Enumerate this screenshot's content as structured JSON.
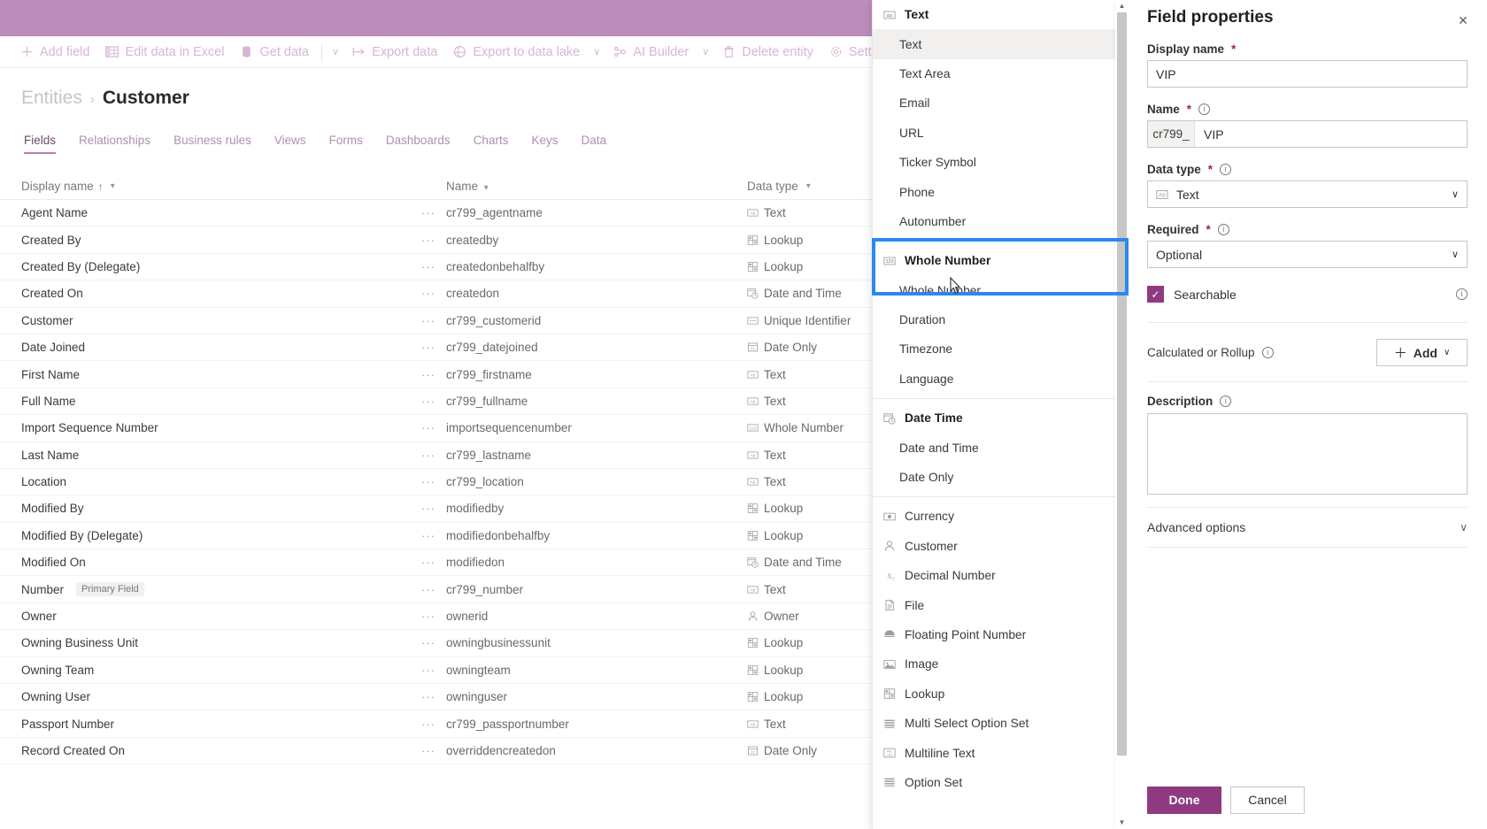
{
  "app": {
    "header_color": "#bb8dba",
    "accent_color": "#8f3a80",
    "focus_ring_color": "#2b88f0"
  },
  "command_bar": {
    "items": [
      {
        "label": "Add field",
        "icon": "plus-icon"
      },
      {
        "label": "Edit data in Excel",
        "icon": "excel-icon"
      },
      {
        "label": "Get data",
        "icon": "database-icon",
        "has_chevron": true
      },
      {
        "label": "Export data",
        "icon": "export-icon"
      },
      {
        "label": "Export to data lake",
        "icon": "datalake-icon",
        "has_chevron": true
      },
      {
        "label": "AI Builder",
        "icon": "ai-builder-icon",
        "has_chevron": true
      },
      {
        "label": "Delete entity",
        "icon": "trash-icon"
      },
      {
        "label": "Settings",
        "icon": "gear-icon"
      }
    ]
  },
  "breadcrumb": {
    "root": "Entities",
    "separator": "›",
    "current": "Customer"
  },
  "tabs": [
    {
      "label": "Fields",
      "active": true
    },
    {
      "label": "Relationships",
      "active": false
    },
    {
      "label": "Business rules",
      "active": false
    },
    {
      "label": "Views",
      "active": false
    },
    {
      "label": "Forms",
      "active": false
    },
    {
      "label": "Dashboards",
      "active": false
    },
    {
      "label": "Charts",
      "active": false
    },
    {
      "label": "Keys",
      "active": false
    },
    {
      "label": "Data",
      "active": false
    }
  ],
  "grid": {
    "columns": [
      {
        "label": "Display name",
        "sorted": "asc",
        "sort_glyph": "↑"
      },
      {
        "label": "Name"
      },
      {
        "label": "Data type"
      }
    ],
    "rows": [
      {
        "display_name": "Agent Name",
        "badge": "",
        "name": "cr799_agentname",
        "data_type": "Text",
        "type_icon": "text-icon"
      },
      {
        "display_name": "Created By",
        "badge": "",
        "name": "createdby",
        "data_type": "Lookup",
        "type_icon": "lookup-icon"
      },
      {
        "display_name": "Created By (Delegate)",
        "badge": "",
        "name": "createdonbehalfby",
        "data_type": "Lookup",
        "type_icon": "lookup-icon"
      },
      {
        "display_name": "Created On",
        "badge": "",
        "name": "createdon",
        "data_type": "Date and Time",
        "type_icon": "datetime-icon"
      },
      {
        "display_name": "Customer",
        "badge": "",
        "name": "cr799_customerid",
        "data_type": "Unique Identifier",
        "type_icon": "guid-icon"
      },
      {
        "display_name": "Date Joined",
        "badge": "",
        "name": "cr799_datejoined",
        "data_type": "Date Only",
        "type_icon": "dateonly-icon"
      },
      {
        "display_name": "First Name",
        "badge": "",
        "name": "cr799_firstname",
        "data_type": "Text",
        "type_icon": "text-icon"
      },
      {
        "display_name": "Full Name",
        "badge": "",
        "name": "cr799_fullname",
        "data_type": "Text",
        "type_icon": "text-icon"
      },
      {
        "display_name": "Import Sequence Number",
        "badge": "",
        "name": "importsequencenumber",
        "data_type": "Whole Number",
        "type_icon": "wholenumber-icon"
      },
      {
        "display_name": "Last Name",
        "badge": "",
        "name": "cr799_lastname",
        "data_type": "Text",
        "type_icon": "text-icon"
      },
      {
        "display_name": "Location",
        "badge": "",
        "name": "cr799_location",
        "data_type": "Text",
        "type_icon": "text-icon"
      },
      {
        "display_name": "Modified By",
        "badge": "",
        "name": "modifiedby",
        "data_type": "Lookup",
        "type_icon": "lookup-icon"
      },
      {
        "display_name": "Modified By (Delegate)",
        "badge": "",
        "name": "modifiedonbehalfby",
        "data_type": "Lookup",
        "type_icon": "lookup-icon"
      },
      {
        "display_name": "Modified On",
        "badge": "",
        "name": "modifiedon",
        "data_type": "Date and Time",
        "type_icon": "datetime-icon"
      },
      {
        "display_name": "Number",
        "badge": "Primary Field",
        "name": "cr799_number",
        "data_type": "Text",
        "type_icon": "text-icon"
      },
      {
        "display_name": "Owner",
        "badge": "",
        "name": "ownerid",
        "data_type": "Owner",
        "type_icon": "owner-icon"
      },
      {
        "display_name": "Owning Business Unit",
        "badge": "",
        "name": "owningbusinessunit",
        "data_type": "Lookup",
        "type_icon": "lookup-icon"
      },
      {
        "display_name": "Owning Team",
        "badge": "",
        "name": "owningteam",
        "data_type": "Lookup",
        "type_icon": "lookup-icon"
      },
      {
        "display_name": "Owning User",
        "badge": "",
        "name": "owninguser",
        "data_type": "Lookup",
        "type_icon": "lookup-icon"
      },
      {
        "display_name": "Passport Number",
        "badge": "",
        "name": "cr799_passportnumber",
        "data_type": "Text",
        "type_icon": "text-icon"
      },
      {
        "display_name": "Record Created On",
        "badge": "",
        "name": "overriddencreatedon",
        "data_type": "Date Only",
        "type_icon": "dateonly-icon"
      }
    ],
    "row_ellipsis": "···"
  },
  "type_menu": {
    "entries": [
      {
        "kind": "group",
        "label": "Text",
        "icon": "text-icon"
      },
      {
        "kind": "item",
        "label": "Text",
        "selected": true
      },
      {
        "kind": "item",
        "label": "Text Area",
        "selected": false
      },
      {
        "kind": "item",
        "label": "Email",
        "selected": false
      },
      {
        "kind": "item",
        "label": "URL",
        "selected": false
      },
      {
        "kind": "item",
        "label": "Ticker Symbol",
        "selected": false
      },
      {
        "kind": "item",
        "label": "Phone",
        "selected": false
      },
      {
        "kind": "item",
        "label": "Autonumber",
        "selected": false
      },
      {
        "kind": "divider"
      },
      {
        "kind": "group",
        "label": "Whole Number",
        "icon": "wholenumber-icon",
        "focused": true
      },
      {
        "kind": "item",
        "label": "Whole Number",
        "selected": false,
        "focused": true
      },
      {
        "kind": "item",
        "label": "Duration",
        "selected": false
      },
      {
        "kind": "item",
        "label": "Timezone",
        "selected": false
      },
      {
        "kind": "item",
        "label": "Language",
        "selected": false
      },
      {
        "kind": "divider"
      },
      {
        "kind": "group",
        "label": "Date Time",
        "icon": "datetime-icon"
      },
      {
        "kind": "item",
        "label": "Date and Time",
        "selected": false
      },
      {
        "kind": "item",
        "label": "Date Only",
        "selected": false
      },
      {
        "kind": "divider"
      },
      {
        "kind": "flat",
        "label": "Currency",
        "icon": "currency-icon"
      },
      {
        "kind": "flat",
        "label": "Customer",
        "icon": "customer-icon"
      },
      {
        "kind": "flat",
        "label": "Decimal Number",
        "icon": "decimal-icon"
      },
      {
        "kind": "flat",
        "label": "File",
        "icon": "file-icon"
      },
      {
        "kind": "flat",
        "label": "Floating Point Number",
        "icon": "float-icon"
      },
      {
        "kind": "flat",
        "label": "Image",
        "icon": "image-icon"
      },
      {
        "kind": "flat",
        "label": "Lookup",
        "icon": "lookup-icon"
      },
      {
        "kind": "flat",
        "label": "Multi Select Option Set",
        "icon": "optionset-icon"
      },
      {
        "kind": "flat",
        "label": "Multiline Text",
        "icon": "multiline-icon"
      },
      {
        "kind": "flat",
        "label": "Option Set",
        "icon": "optionset-icon"
      }
    ]
  },
  "field_panel": {
    "title": "Field properties",
    "close_label": "✕",
    "display_name": {
      "label": "Display name",
      "required": "*",
      "value": "VIP"
    },
    "name": {
      "label": "Name",
      "required": "*",
      "prefix": "cr799_",
      "value": "VIP"
    },
    "data_type": {
      "label": "Data type",
      "required": "*",
      "value": "Text",
      "icon": "text-icon",
      "chevron": "∨"
    },
    "required": {
      "label": "Required",
      "required": "*",
      "value": "Optional",
      "chevron": "∨"
    },
    "searchable": {
      "label": "Searchable",
      "checked": true,
      "check_glyph": "✓"
    },
    "calculated": {
      "label": "Calculated or Rollup",
      "button_label": "Add",
      "button_plus": "＋",
      "button_chevron": "∨"
    },
    "description": {
      "label": "Description",
      "value": ""
    },
    "advanced_options": {
      "label": "Advanced options",
      "chevron": "∨"
    },
    "footer": {
      "done": "Done",
      "cancel": "Cancel"
    }
  }
}
